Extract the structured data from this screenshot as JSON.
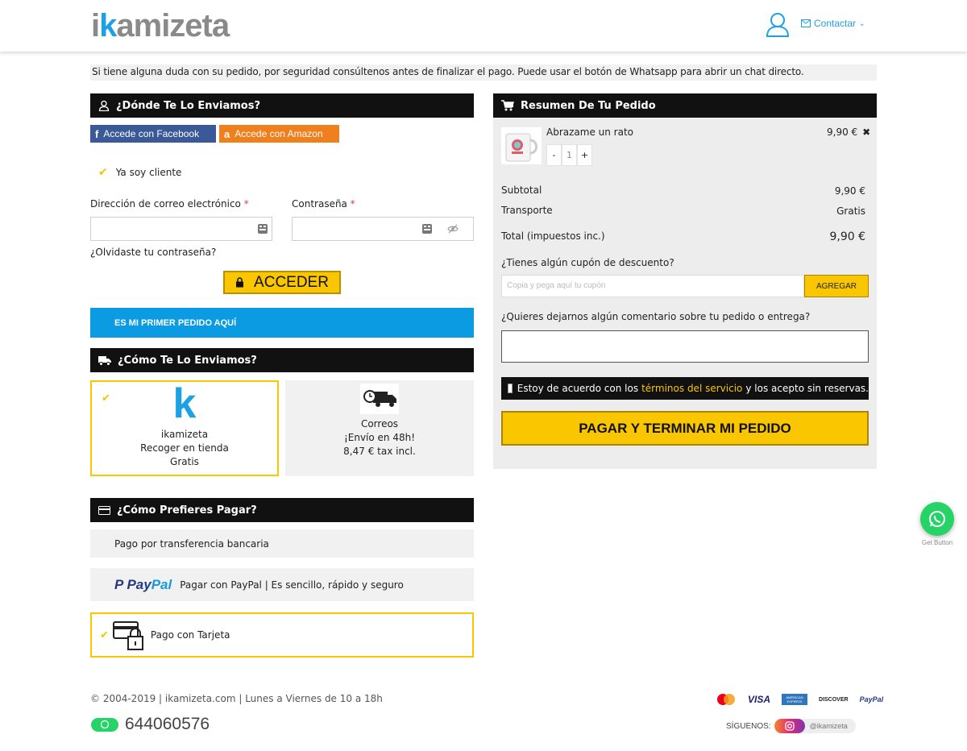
{
  "header": {
    "logo_k": "k",
    "logo_rest": "i kamizeta",
    "contact_label": "Contactar"
  },
  "notice": "Si tiene alguna duda con su pedido, por seguridad consúltenos antes de finalizar el pago. Puede usar el botón de Whatsapp para abrir un chat directo.",
  "shipping_address": {
    "title": "¿Dónde Te Lo Enviamos?",
    "facebook_label": "Accede con Facebook",
    "amazon_label": "Accede con Amazon",
    "existing_customer": "Ya soy cliente",
    "email_label": "Dirección de correo electrónico",
    "email_value": "",
    "password_label": "Contraseña",
    "password_value": "",
    "required_mark": "*",
    "forgot_password": "¿Olvidaste tu contraseña?",
    "login_button": "ACCEDER",
    "first_order_button": "ES MI PRIMER PEDIDO AQUÍ"
  },
  "shipping_method": {
    "title": "¿Cómo Te Lo Enviamos?",
    "options": [
      {
        "line1": "ikamizeta",
        "line2": "Recoger en tienda",
        "line3": "Gratis",
        "selected": true
      },
      {
        "line1": "Correos",
        "line2": "¡Envío en 48h!",
        "line3": "8,47 € tax incl.",
        "selected": false
      }
    ]
  },
  "payment": {
    "title": "¿Cómo Prefieres Pagar?",
    "options": [
      {
        "label": "Pago por transferencia bancaria",
        "selected": false
      },
      {
        "logo_a": "Pay",
        "logo_b": "Pal",
        "label": "Pagar con PayPal | Es sencillo, rápido y seguro",
        "selected": false
      },
      {
        "label": "Pago con Tarjeta",
        "selected": true
      }
    ]
  },
  "order_summary": {
    "title": "Resumen De Tu Pedido",
    "product": {
      "name": "Abrazame un rato",
      "price": "9,90 €",
      "quantity": "1",
      "minus": "-",
      "plus": "+"
    },
    "subtotal_label": "Subtotal",
    "subtotal_value": "9,90 €",
    "shipping_label": "Transporte",
    "shipping_value": "Gratis",
    "total_label": "Total (impuestos inc.)",
    "total_value": "9,90 €",
    "coupon_question": "¿Tienes algún cupón de descuento?",
    "coupon_placeholder": "Copia y pega aquí tu cupón",
    "coupon_button": "AGREGAR",
    "comment_question": "¿Quieres dejarnos algún comentario sobre tu pedido o entrega?",
    "comment_value": "",
    "terms_before": "Estoy de acuerdo con los",
    "terms_link": "términos del servicio",
    "terms_after": "y los acepto sin reservas.",
    "pay_button": "PAGAR Y TERMINAR MI PEDIDO"
  },
  "whatsapp": {
    "label": "Get Button"
  },
  "footer": {
    "info": "© 2004-2019 | ikamizeta.com | Lunes a Viernes de 10 a 18h",
    "phone": "644060576",
    "card_visa": "VISA",
    "card_amex": "AMERICAN EXPRESS",
    "card_discover": "DISCOVER",
    "card_paypal": "PayPal",
    "follow_label": "SÍGUENOS:",
    "instagram_handle": "@ikamizeta"
  },
  "colors": {
    "accent_yellow": "#f9c600",
    "brand_blue": "#1da1e3",
    "header_black": "#111111",
    "first_order_blue": "#0b9be3"
  }
}
